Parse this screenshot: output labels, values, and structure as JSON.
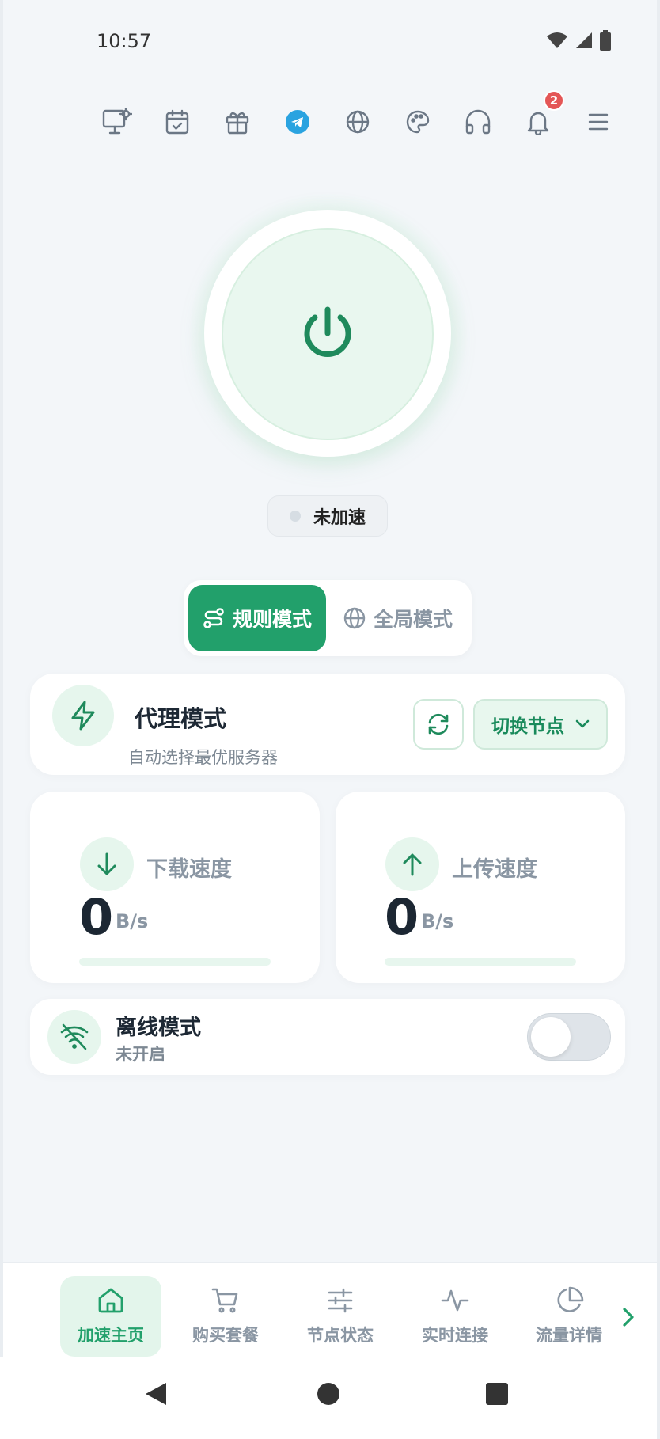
{
  "status_bar": {
    "time": "10:57"
  },
  "toolbar": {
    "icons": [
      "monitor-settings-icon",
      "calendar-check-icon",
      "gift-icon",
      "telegram-icon",
      "globe-icon",
      "palette-icon",
      "headphones-icon",
      "bell-icon",
      "menu-icon"
    ],
    "notification_count": "2",
    "accent": "#2aa3e0",
    "badge_color": "#e45656"
  },
  "power": {
    "status_text": "未加速",
    "accent": "#1f8a5c"
  },
  "mode_switch": {
    "rule_mode": "规则模式",
    "global_mode": "全局模式",
    "active": "rule_mode"
  },
  "proxy_card": {
    "title": "代理模式",
    "subtitle": "自动选择最优服务器",
    "switch_node": "切换节点"
  },
  "speed": {
    "download": {
      "label": "下载速度",
      "value": "0",
      "unit": "B/s",
      "fill_fraction": 0
    },
    "upload": {
      "label": "上传速度",
      "value": "0",
      "unit": "B/s",
      "fill_fraction": 0
    }
  },
  "offline": {
    "title": "离线模式",
    "status": "未开启",
    "enabled": false
  },
  "bottom_nav": {
    "items": [
      {
        "label": "加速主页",
        "icon": "home-icon",
        "active": true
      },
      {
        "label": "购买套餐",
        "icon": "cart-icon",
        "active": false
      },
      {
        "label": "节点状态",
        "icon": "sliders-icon",
        "active": false
      },
      {
        "label": "实时连接",
        "icon": "activity-icon",
        "active": false
      },
      {
        "label": "流量详情",
        "icon": "pie-chart-icon",
        "active": false
      }
    ]
  },
  "colors": {
    "primary": "#22a06b",
    "primary_light": "#e6f6ed",
    "background": "#f3f6f9"
  }
}
